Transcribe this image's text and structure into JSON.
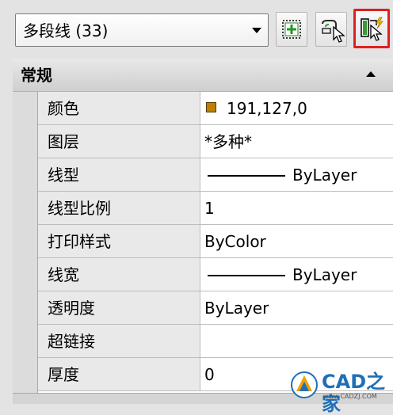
{
  "toolbar": {
    "object_select": {
      "value": "多段线 (33)"
    },
    "buttons": [
      {
        "name": "toggle-pickadd-button",
        "icon": "pickadd-plus-icon"
      },
      {
        "name": "select-objects-button",
        "icon": "select-objects-cursor-icon"
      },
      {
        "name": "quick-select-button",
        "icon": "quick-select-icon",
        "highlighted": true
      }
    ],
    "highlight_color": "#e02020"
  },
  "panel": {
    "group": {
      "title": "常规"
    },
    "rows": [
      {
        "label": "颜色",
        "value": "191,127,0",
        "swatch_color": "#bf7f00"
      },
      {
        "label": "图层",
        "value": "*多种*"
      },
      {
        "label": "线型",
        "value": "ByLayer",
        "line_sample": true
      },
      {
        "label": "线型比例",
        "value": "1"
      },
      {
        "label": "打印样式",
        "value": "ByColor"
      },
      {
        "label": "线宽",
        "value": "ByLayer",
        "line_sample": true
      },
      {
        "label": "透明度",
        "value": "ByLayer"
      },
      {
        "label": "超链接",
        "value": ""
      },
      {
        "label": "厚度",
        "value": "0"
      }
    ]
  },
  "watermark": {
    "text": "CAD之家",
    "url": "www.CADZJ.COM"
  }
}
